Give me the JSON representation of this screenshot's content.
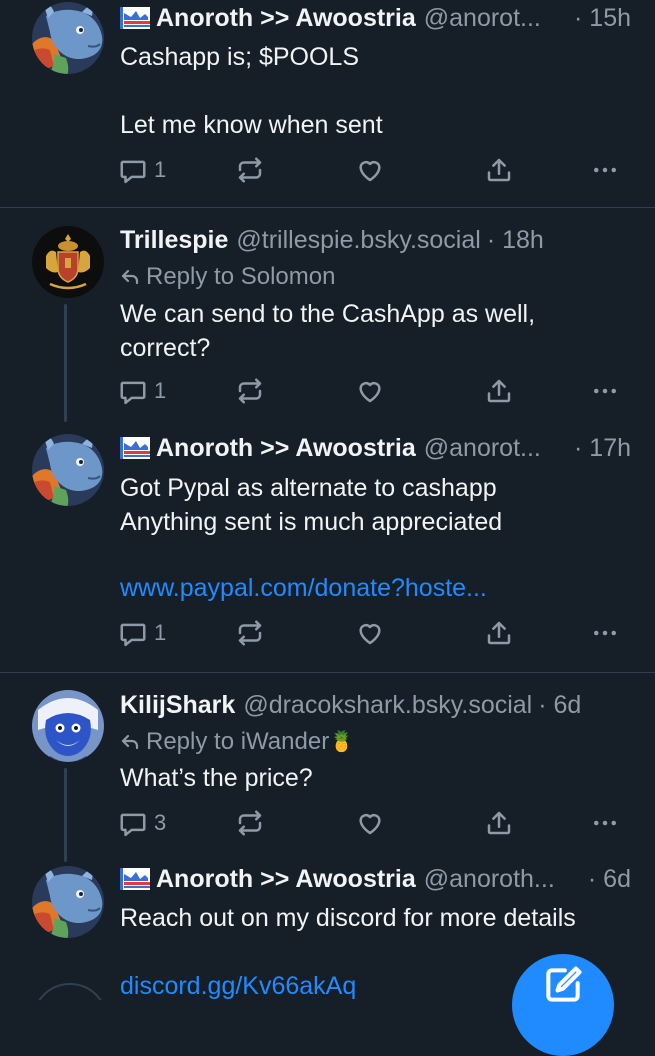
{
  "posts": [
    {
      "author": "Anoroth >> Awoostria",
      "handle": "@anorot...",
      "time": "· 15h",
      "text": "Cashapp is; $POOLS\n\nLet me know when sent",
      "reply_count": "1"
    },
    {
      "author": "Trillespie",
      "handle": "@trillespie.bsky.social",
      "time": "· 18h",
      "reply_to": "Reply to Solomon",
      "text": "We can send to the CashApp as well,\ncorrect?",
      "reply_count": "1"
    },
    {
      "author": "Anoroth >> Awoostria",
      "handle": "@anorot...",
      "time": "· 17h",
      "text": "Got Pypal as alternate to cashapp\nAnything sent is much appreciated",
      "link": "www.paypal.com/donate?hoste...",
      "reply_count": "1"
    },
    {
      "author": "KilijShark",
      "handle": "@dracokshark.bsky.social",
      "time": "· 6d",
      "reply_to": "Reply to iWander",
      "reply_to_emoji": "🍍",
      "text": "What’s the price?",
      "reply_count": "3"
    },
    {
      "author": "Anoroth >> Awoostria",
      "handle": "@anoroth...",
      "time": "· 6d",
      "text": "Reach out on my discord for more details",
      "link": "discord.gg/Kv66akAq"
    }
  ],
  "icons": {
    "reply": "speech-bubble-icon",
    "repost": "repost-icon",
    "like": "heart-icon",
    "share": "share-icon",
    "more": "more-icon",
    "compose": "compose-icon"
  },
  "colors": {
    "background": "#161e27",
    "muted": "#8d9aa8",
    "link": "#208bfe",
    "divider": "#2e4052"
  }
}
